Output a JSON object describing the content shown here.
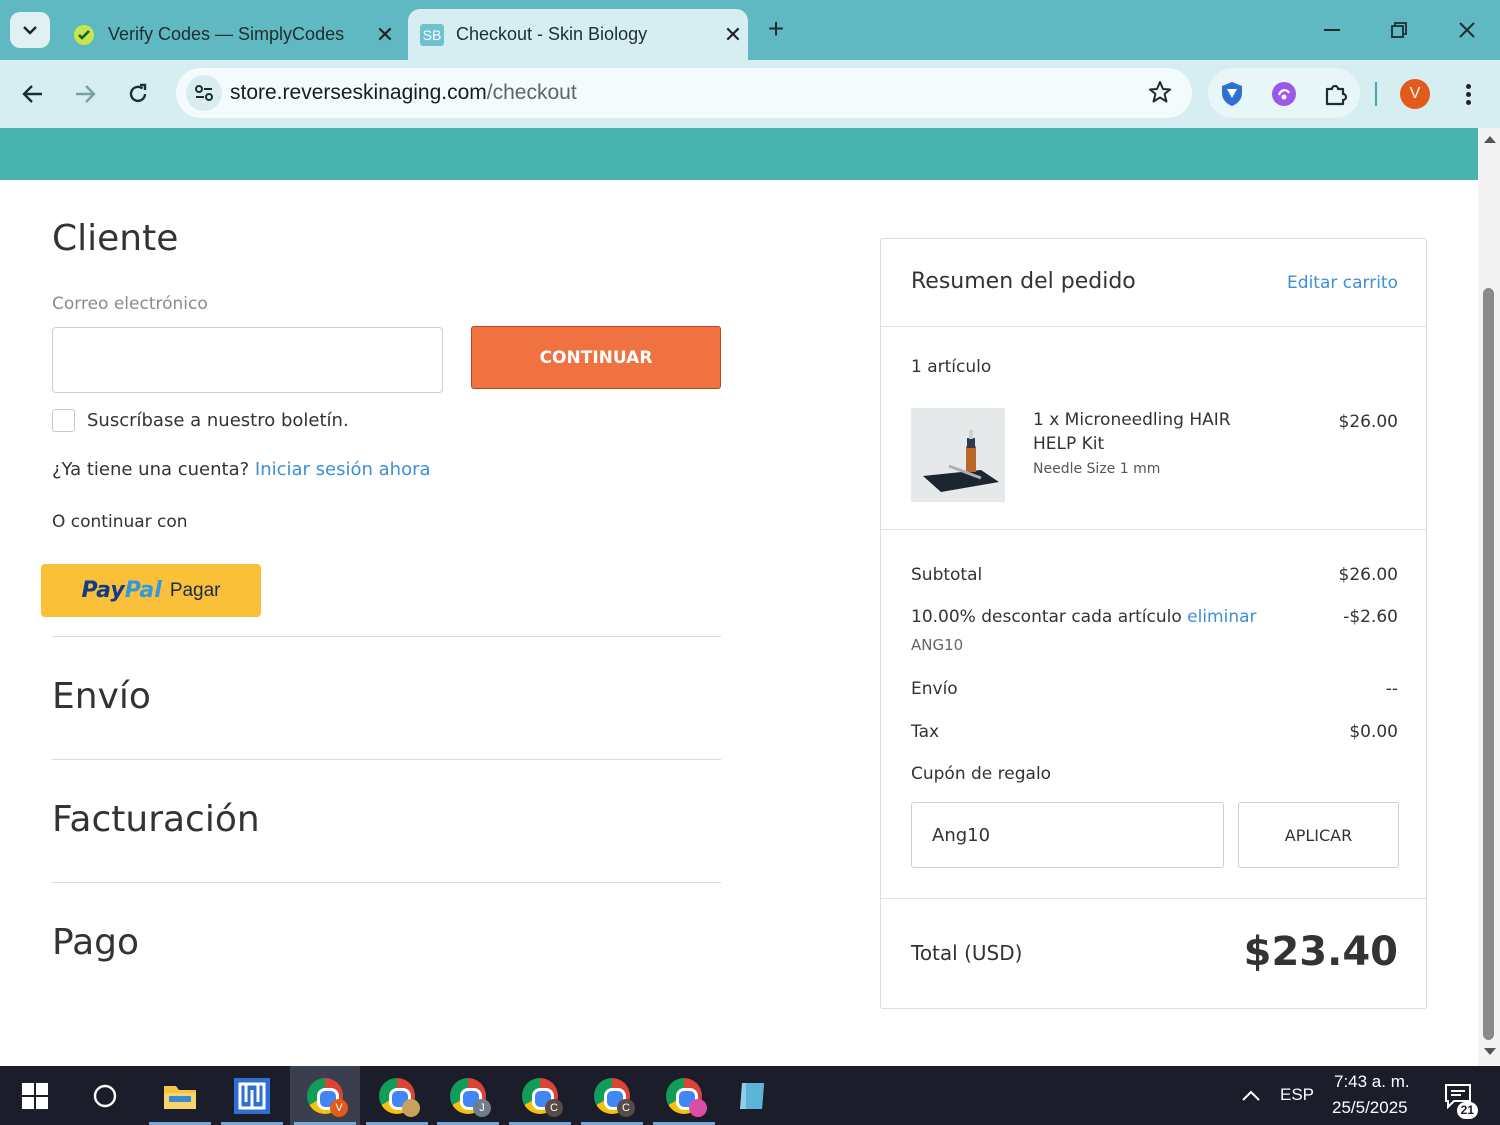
{
  "browser": {
    "tabs": [
      {
        "title": "Verify Codes — SimplyCodes",
        "active": false
      },
      {
        "title": "Checkout - Skin Biology",
        "favicon_text": "SB",
        "active": true
      }
    ],
    "url": {
      "host": "store.reverseskinaging.com",
      "path": "/checkout"
    },
    "profile_initial": "V"
  },
  "checkout": {
    "customer_heading": "Cliente",
    "email_label": "Correo electrónico",
    "email_value": "",
    "continue_label": "CONTINUAR",
    "newsletter_label": "Suscríbase a nuestro boletín.",
    "account_question": "¿Ya tiene una cuenta?",
    "login_link": "Iniciar sesión ahora",
    "or_continue": "O continuar con",
    "paypal": {
      "brand_part1": "Pay",
      "brand_part2": "Pal",
      "label": "Pagar"
    },
    "shipping_heading": "Envío",
    "billing_heading": "Facturación",
    "payment_heading": "Pago"
  },
  "summary": {
    "title": "Resumen del pedido",
    "edit_link": "Editar carrito",
    "item_count": "1 artículo",
    "item": {
      "name": "1 x Microneedling HAIR HELP Kit",
      "variant": "Needle Size 1 mm",
      "price": "$26.00"
    },
    "subtotal_label": "Subtotal",
    "subtotal_value": "$26.00",
    "discount_label": "10.00% descontar cada artículo",
    "discount_remove": "eliminar",
    "discount_code": "ANG10",
    "discount_value": "-$2.60",
    "shipping_label": "Envío",
    "shipping_value": "--",
    "tax_label": "Tax",
    "tax_value": "$0.00",
    "gift_link": "Cupón de regalo",
    "coupon_value": "Ang10",
    "apply_label": "APLICAR",
    "total_label": "Total (USD)",
    "total_value": "$23.40"
  },
  "taskbar": {
    "language": "ESP",
    "time": "7:43 a. m.",
    "date": "25/5/2025",
    "notifications": "21",
    "chrome_badges": [
      "V",
      "",
      "J",
      "C",
      "C",
      ""
    ]
  },
  "colors": {
    "tabbar": "#5fb8c2",
    "banner": "#49b3ae",
    "continue_button": "#ef7240",
    "paypal_button": "#fbc03a",
    "link": "#3d8fd6"
  }
}
